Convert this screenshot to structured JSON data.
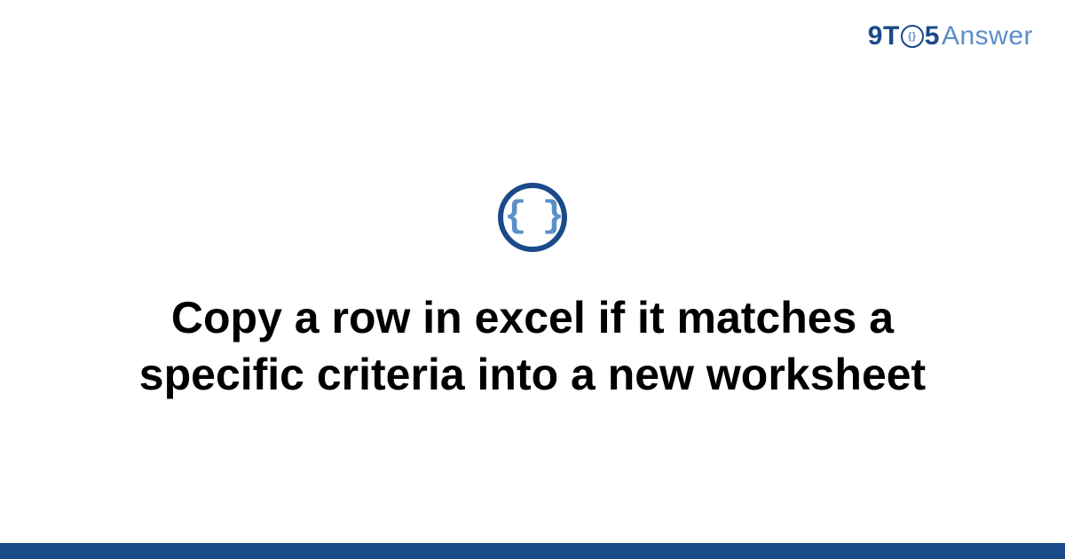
{
  "brand": {
    "part1": "9",
    "part2": "T",
    "o_inner": "{}",
    "part3": "5",
    "part4": "Answer"
  },
  "logo": {
    "braces": "{ }"
  },
  "title": "Copy a row in excel if it matches a specific criteria into a new worksheet",
  "colors": {
    "primary": "#1a4a8a",
    "secondary": "#5a8fc8"
  }
}
